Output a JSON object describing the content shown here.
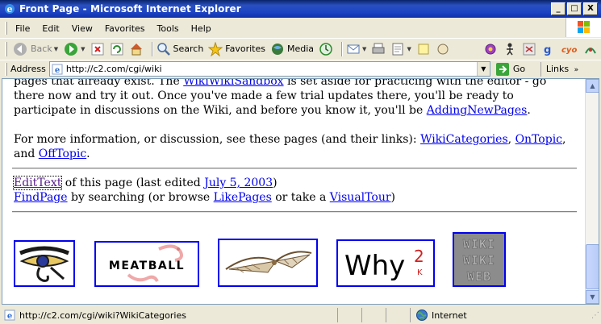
{
  "window": {
    "title": "Front Page - Microsoft Internet Explorer",
    "controls": {
      "minimize": "_",
      "maximize": "□",
      "close": "X"
    }
  },
  "menu": [
    "File",
    "Edit",
    "View",
    "Favorites",
    "Tools",
    "Help"
  ],
  "toolbar": {
    "back_label": "Back",
    "search_label": "Search",
    "favorites_label": "Favorites",
    "media_label": "Media"
  },
  "address": {
    "label": "Address",
    "url": "http://c2.com/cgi/wiki",
    "go_label": "Go",
    "links_label": "Links"
  },
  "page": {
    "para1": {
      "t1": "pages that already exist. The ",
      "link1": "WikiWikiSandbox",
      "t2": " is set aside for practicing with the editor - go there now and try it out. Once you've made a few trial updates there, you'll be ready to participate in discussions on the Wiki, and before you know it, you'll be ",
      "link2": "AddingNewPages",
      "t3": "."
    },
    "para2": {
      "t1": "For more information, or discussion, see these pages (and their links): ",
      "link1": "WikiCategories",
      "t2": ", ",
      "link2": "OnTopic",
      "t3": ", and ",
      "link3": "OffTopic",
      "t4": "."
    },
    "footer": {
      "edit_link": "EditText",
      "edit_text": " of this page (last edited ",
      "date_link": "July 5, 2003",
      "edit_close": ")",
      "find_link": "FindPage",
      "find_text": " by searching (or browse ",
      "like_link": "LikePages",
      "or_text": " or take a ",
      "tour_link": "VisualTour",
      "find_close": ")"
    },
    "logos": {
      "meatball_text": "MEATBALL",
      "why_text": "Why",
      "why_sup": "2",
      "why_k": "K",
      "wiki_row1": "WIKI",
      "wiki_row2": "WIKI",
      "wiki_row3": "WEB"
    }
  },
  "status": {
    "text": "http://c2.com/cgi/wiki?WikiCategories",
    "zone": "Internet"
  },
  "colors": {
    "link": "#0000ee",
    "visited": "#551a8b",
    "titlebar": "#0a246a",
    "logo_border": "#0000ee"
  }
}
